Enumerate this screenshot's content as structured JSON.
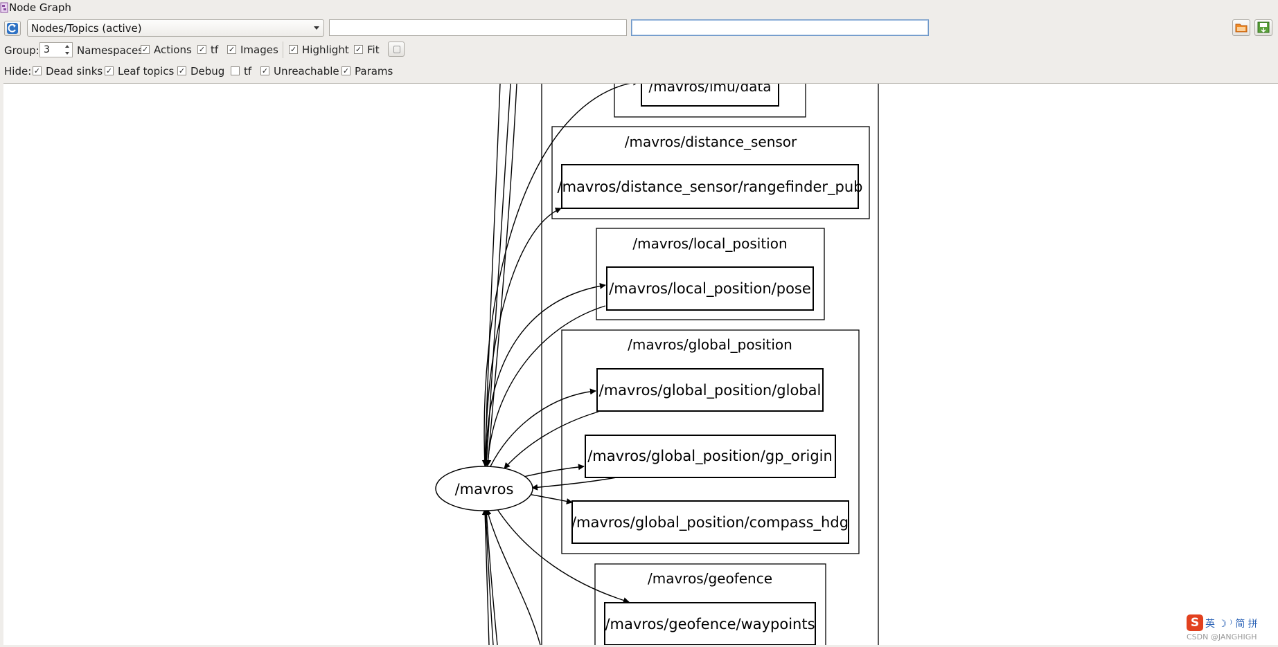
{
  "window": {
    "title": "Node Graph"
  },
  "toolbar": {
    "graph_type": "Nodes/Topics (active)",
    "node_filter": "",
    "topic_filter": "",
    "group_label": "Group:",
    "group_value": "3",
    "options": [
      {
        "label": "Namespaces",
        "checked": null
      },
      {
        "label": "Actions",
        "checked": true
      },
      {
        "label": "tf",
        "checked": true
      },
      {
        "label": "Images",
        "checked": true
      },
      {
        "label": "Highlight",
        "checked": true
      },
      {
        "label": "Fit",
        "checked": true
      }
    ],
    "hide_label": "Hide:",
    "hide": [
      {
        "label": "Dead sinks",
        "checked": true
      },
      {
        "label": "Leaf topics",
        "checked": true
      },
      {
        "label": "Debug",
        "checked": true
      },
      {
        "label": "tf",
        "checked": false
      },
      {
        "label": "Unreachable",
        "checked": true
      },
      {
        "label": "Params",
        "checked": true
      }
    ]
  },
  "graph": {
    "node": "/mavros",
    "clusters": [
      {
        "name": "/mavros/imu",
        "label": "",
        "topics": [
          "/mavros/imu/data"
        ]
      },
      {
        "name": "/mavros/distance_sensor",
        "label": "/mavros/distance_sensor",
        "topics": [
          "/mavros/distance_sensor/rangefinder_pub"
        ]
      },
      {
        "name": "/mavros/local_position",
        "label": "/mavros/local_position",
        "topics": [
          "/mavros/local_position/pose"
        ]
      },
      {
        "name": "/mavros/global_position",
        "label": "/mavros/global_position",
        "topics": [
          "/mavros/global_position/global",
          "/mavros/global_position/gp_origin",
          "/mavros/global_position/compass_hdg"
        ]
      },
      {
        "name": "/mavros/geofence",
        "label": "/mavros/geofence",
        "topics": [
          "/mavros/geofence/waypoints"
        ]
      }
    ]
  },
  "watermark": {
    "ime": "英 ☽ ⁾ 简 拼",
    "credit": "CSDN @JANGHIGH"
  },
  "colors": {
    "background": "#efedea",
    "canvas": "#ffffff",
    "accent": "#2a62b6",
    "logo": "#e2411f"
  }
}
